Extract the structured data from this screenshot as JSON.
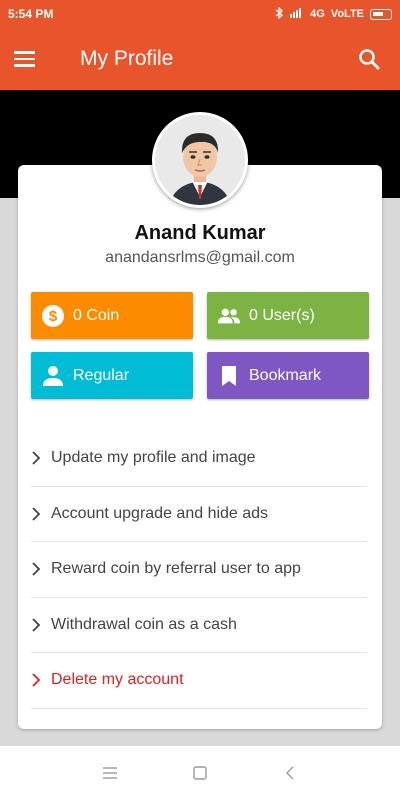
{
  "status_bar": {
    "time": "5:54 PM",
    "network": "4G",
    "network_type": "VoLTE"
  },
  "app_bar": {
    "title": "My Profile",
    "menu_icon": "hamburger-menu-icon",
    "search_icon": "search-icon"
  },
  "profile": {
    "name": "Anand Kumar",
    "email": "anandansrlms@gmail.com",
    "avatar_icon": "avatar-illustration"
  },
  "tiles": {
    "coin": {
      "label": "0 Coin",
      "icon": "dollar-coin-icon",
      "color": "#fb8c00"
    },
    "users": {
      "label": "0 User(s)",
      "icon": "group-icon",
      "color": "#7cb342"
    },
    "regular": {
      "label": "Regular",
      "icon": "person-icon",
      "color": "#00bcd4"
    },
    "bookmark": {
      "label": "Bookmark",
      "icon": "bookmark-icon",
      "color": "#7e57c2"
    }
  },
  "menu": {
    "items": [
      {
        "label": "Update my profile and image"
      },
      {
        "label": "Account upgrade and hide ads"
      },
      {
        "label": "Reward coin by referral user to app"
      },
      {
        "label": "Withdrawal coin as a cash"
      },
      {
        "label": "Delete my account"
      }
    ]
  },
  "colors": {
    "primary": "#e8542b",
    "danger": "#e02020"
  }
}
